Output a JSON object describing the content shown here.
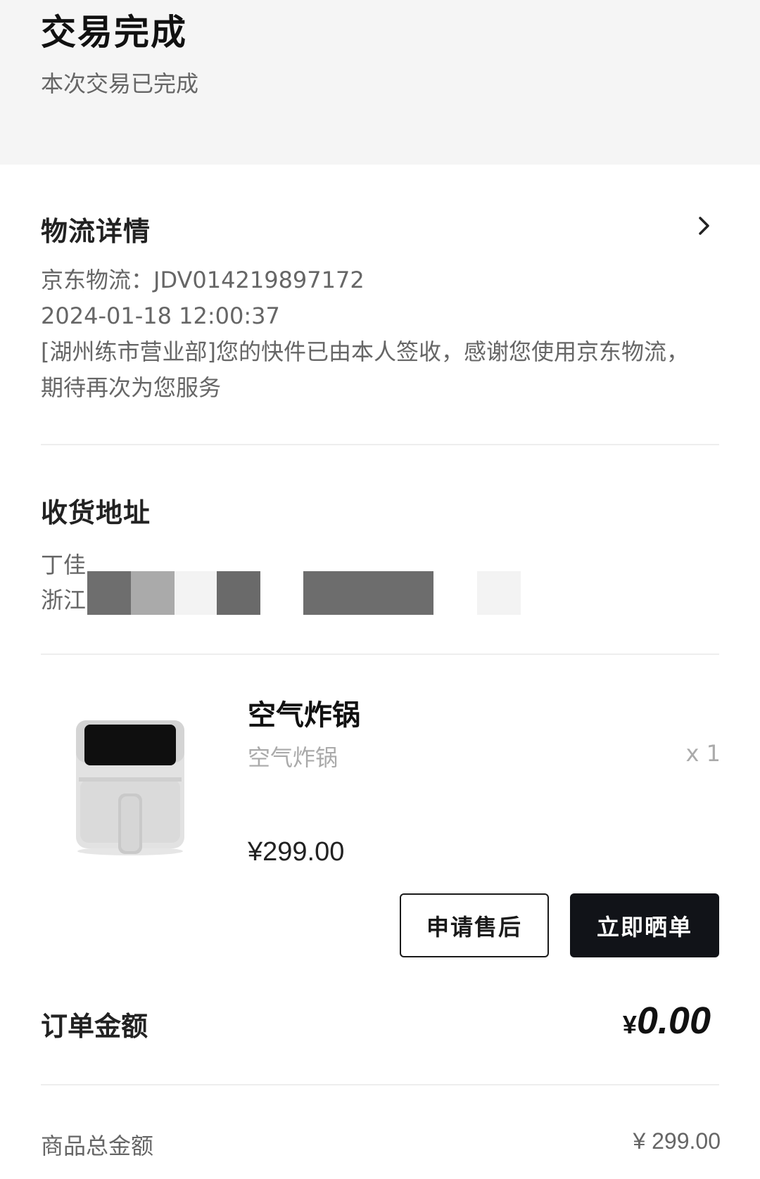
{
  "header": {
    "title": "交易完成",
    "subtitle": "本次交易已完成"
  },
  "logistics": {
    "title": "物流详情",
    "carrier_line": "京东物流：JDV014219897172",
    "time": "2024-01-18 12:00:37",
    "detail": "[湖州练市营业部]您的快件已由本人签收，感谢您使用京东物流，期待再次为您服务"
  },
  "address": {
    "title": "收货地址",
    "name_visible": "丁佳",
    "region_visible": "浙江"
  },
  "product": {
    "name": "空气炸锅",
    "spec": "空气炸锅",
    "qty": "x 1",
    "price": "¥299.00",
    "icon": "air-fryer-image"
  },
  "actions": {
    "after_sale": "申请售后",
    "review": "立即晒单"
  },
  "order": {
    "label": "订单金额",
    "currency": "¥",
    "amount": "0.00"
  },
  "summary": {
    "goods_total_label": "商品总金额",
    "goods_total_value": "¥ 299.00"
  }
}
